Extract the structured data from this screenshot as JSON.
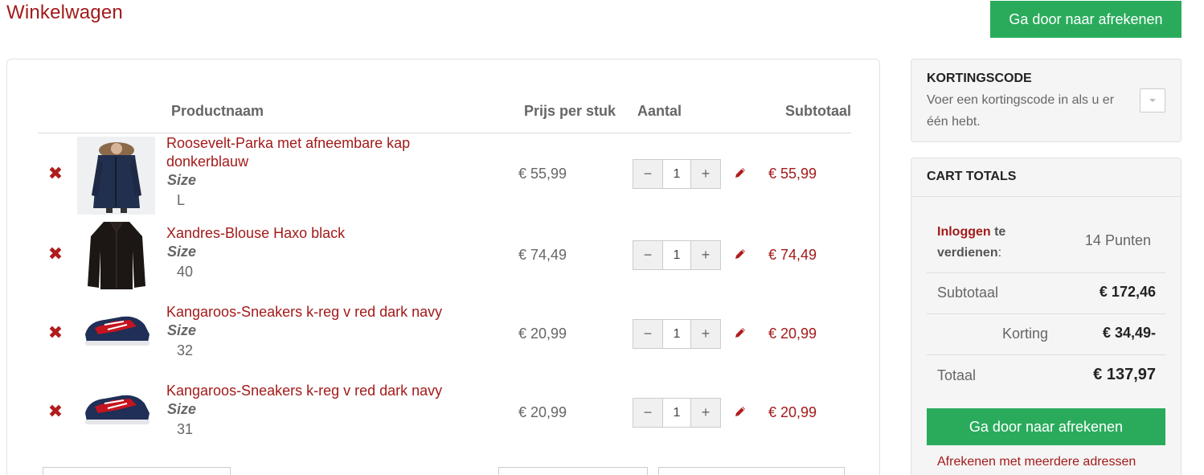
{
  "page": {
    "title": "Winkelwagen",
    "checkout_label": "Ga door naar afrekenen"
  },
  "table": {
    "headers": {
      "name": "Productnaam",
      "price": "Prijs per stuk",
      "qty": "Aantal",
      "subtotal": "Subtotaal"
    },
    "rows": [
      {
        "name": "Roosevelt-Parka met afneembare kap donkerblauw",
        "option_label": "Size",
        "option_value": "L",
        "price": "€ 55,99",
        "qty": "1",
        "subtotal": "€ 55,99",
        "image": "navy-parka"
      },
      {
        "name": "Xandres-Blouse Haxo black",
        "option_label": "Size",
        "option_value": "40",
        "price": "€ 74,49",
        "qty": "1",
        "subtotal": "€ 74,49",
        "image": "black-blouse"
      },
      {
        "name": "Kangaroos-Sneakers k-reg v red dark navy",
        "option_label": "Size",
        "option_value": "32",
        "price": "€ 20,99",
        "qty": "1",
        "subtotal": "€ 20,99",
        "image": "red-navy-sneaker"
      },
      {
        "name": "Kangaroos-Sneakers k-reg v red dark navy",
        "option_label": "Size",
        "option_value": "31",
        "price": "€ 20,99",
        "qty": "1",
        "subtotal": "€ 20,99",
        "image": "red-navy-sneaker"
      }
    ],
    "qty_minus": "−",
    "qty_plus": "+"
  },
  "discount": {
    "title": "KORTINGSCODE",
    "text": "Voer een kortingscode in als u er één hebt."
  },
  "totals": {
    "title": "CART TOTALS",
    "points_link": "Inloggen",
    "points_text_1": " te",
    "points_text_2": "verdienen",
    "points_colon": ":",
    "points_value": "14 Punten",
    "subtotal_label": "Subtotaal",
    "subtotal_value": "€ 172,46",
    "discount_label": "Korting",
    "discount_value": "€ 34,49-",
    "total_label": "Totaal",
    "total_value": "€ 137,97",
    "checkout_label": "Ga door naar afrekenen",
    "multi_address_link": "Afrekenen met meerdere adressen"
  },
  "colors": {
    "accent": "#a31a1a",
    "green": "#2aab5c"
  }
}
